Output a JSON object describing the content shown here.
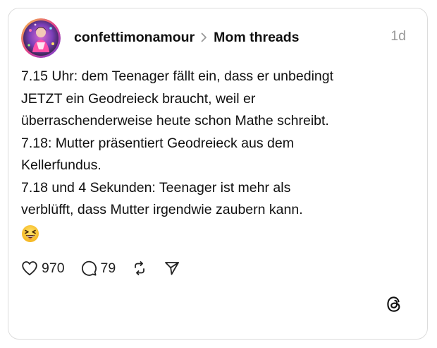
{
  "post": {
    "username": "confettimonamour",
    "thread_name": "Mom threads",
    "time": "1d",
    "lines": [
      "7.15 Uhr: dem Teenager fällt ein, dass er unbedingt",
      "JETZT ein Geodreieck braucht, weil er",
      "überraschenderweise heute schon Mathe schreibt.",
      "7.18: Mutter präsentiert Geodreieck aus dem",
      "Kellerfundus.",
      "7.18 und 4 Sekunden: Teenager ist mehr als",
      "verblüfft, dass Mutter irgendwie zaubern kann."
    ],
    "emoji_icon": "grinning-squinting-face-icon"
  },
  "actions": {
    "like_icon": "heart-icon",
    "likes": "970",
    "reply_icon": "speech-bubble-icon",
    "replies": "79",
    "repost_icon": "repost-icon",
    "share_icon": "send-icon"
  },
  "branding": {
    "logo_icon": "threads-logo-icon"
  },
  "colors": {
    "text": "#101010",
    "muted": "#999999",
    "border": "#dcdcdc"
  }
}
